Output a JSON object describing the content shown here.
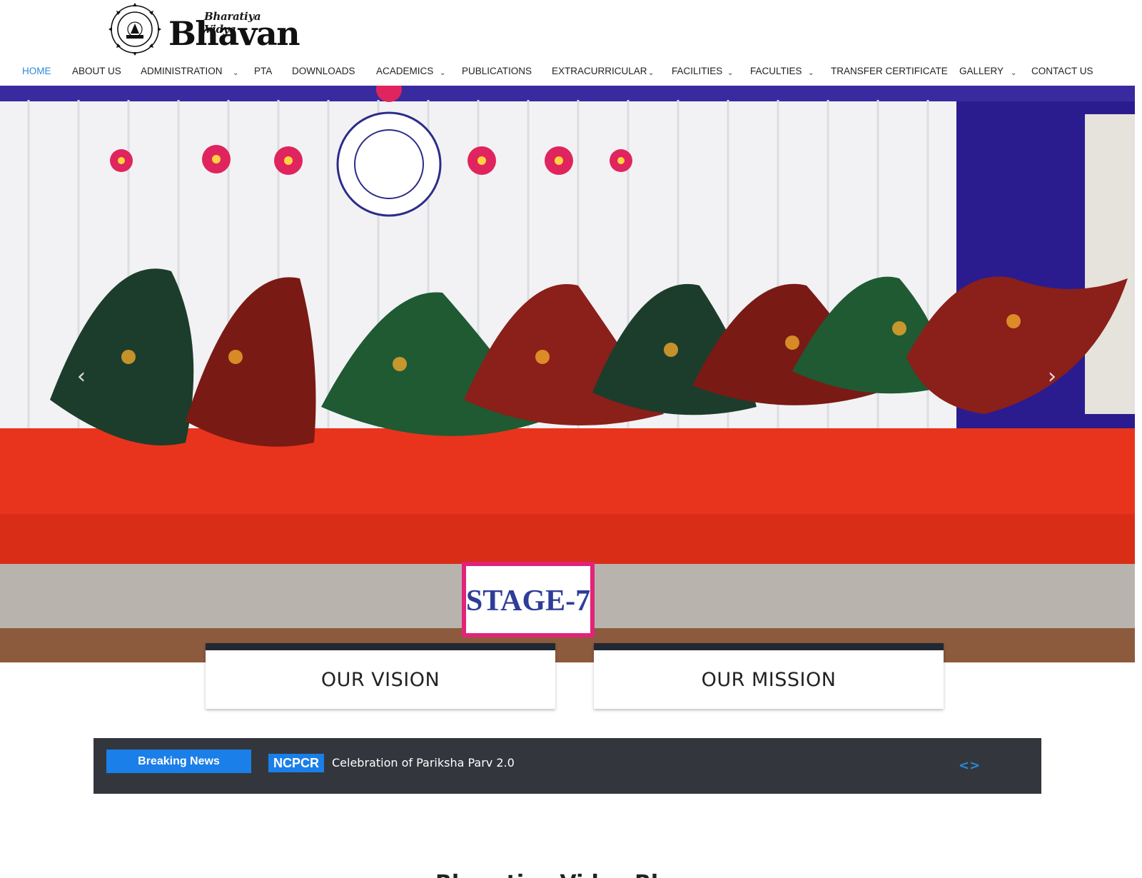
{
  "brand": {
    "name_small": "Bharatiya Vidya",
    "name_big": "Bhavan"
  },
  "nav": {
    "items": [
      {
        "label": "HOME",
        "active": true
      },
      {
        "label": "ABOUT US"
      },
      {
        "label": "ADMINISTRATION",
        "dropdown": true
      },
      {
        "label": "PTA"
      },
      {
        "label": "DOWNLOADS"
      },
      {
        "label": "ACADEMICS",
        "dropdown": true
      },
      {
        "label": "PUBLICATIONS"
      },
      {
        "label": "EXTRACURRICULAR",
        "dropdown": true
      },
      {
        "label": "FACILITIES",
        "dropdown": true
      },
      {
        "label": "FACULTIES",
        "dropdown": true
      },
      {
        "label": "TRANSFER CERTIFICATE"
      },
      {
        "label": "GALLERY",
        "dropdown": true
      },
      {
        "label": "CONTACT US"
      }
    ],
    "caret": "⌄",
    "active_color": "#2a8ad8"
  },
  "hero": {
    "stage_sign": "STAGE-7",
    "prev_icon": "chevron-left-icon",
    "next_icon": "chevron-right-icon",
    "prev_glyph": "‹",
    "next_glyph": "›"
  },
  "cards": {
    "vision": "OUR VISION",
    "mission": "OUR MISSION"
  },
  "news": {
    "label": "Breaking News",
    "tag": "NCPCR",
    "text": "Celebration of Pariksha Parv 2.0",
    "nav": "<>",
    "label_color": "#1a7fe8",
    "bar_color": "#33373d"
  },
  "section": {
    "title": "Bharatiya Vidya Bhavan"
  }
}
